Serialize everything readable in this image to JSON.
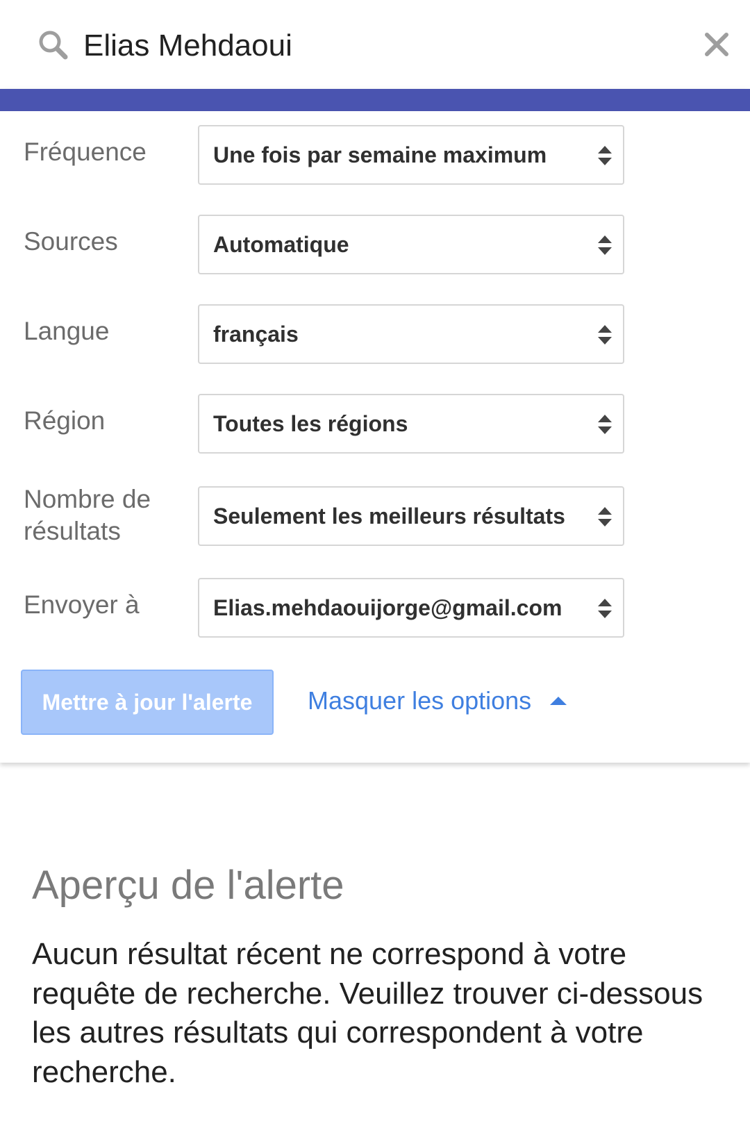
{
  "colors": {
    "accent_bar": "#4a54b0",
    "button_bg": "#a8c7fa",
    "link": "#3f7fe0"
  },
  "search": {
    "icon": "search-icon",
    "query": "Elias Mehdaoui",
    "close_icon": "close-icon"
  },
  "options": [
    {
      "label": "Fréquence",
      "value": "Une fois par semaine maximum"
    },
    {
      "label": "Sources",
      "value": "Automatique"
    },
    {
      "label": "Langue",
      "value": "français"
    },
    {
      "label": "Région",
      "value": "Toutes les régions"
    },
    {
      "label": "Nombre de résultats",
      "value": "Seulement les meilleurs résultats"
    },
    {
      "label": "Envoyer à",
      "value": "Elias.mehdaouijorge@gmail.com"
    }
  ],
  "actions": {
    "update_label": "Mettre à jour l'alerte",
    "toggle_label": "Masquer les options",
    "toggle_icon": "caret-up-icon"
  },
  "preview": {
    "title": "Aperçu de l'alerte",
    "message": "Aucun résultat récent ne correspond à votre requête de recherche. Veuillez trouver ci-dessous les autres résultats qui correspondent à votre recherche."
  }
}
